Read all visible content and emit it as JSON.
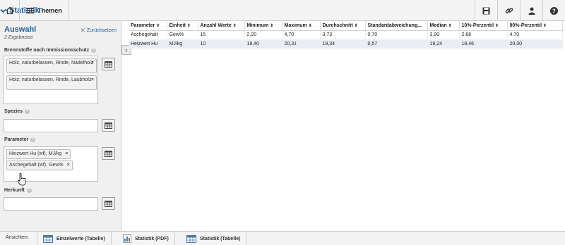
{
  "toolbar": {
    "home_icon": "home-icon",
    "themen_label": "Themen",
    "statistik_label": "Statistik",
    "right_icons": [
      "save-icon",
      "link-icon",
      "user-icon",
      "help-icon"
    ]
  },
  "sidebar": {
    "title": "Auswahl",
    "result_count": "2 Ergebnisse",
    "reset_label": "Zurücksetzen",
    "fuels": {
      "label": "Brennstoffe nach Immissionsschutz",
      "tags": [
        "Holz, naturbelassen, Rinde, Nadelholz",
        "Holz, naturbelassen, Rinde, Laubholz"
      ]
    },
    "species": {
      "label": "Spezies",
      "value": ""
    },
    "parameter": {
      "label": "Parameter",
      "tags": [
        "Heizwert Hu (wf), MJ/kg",
        "Aschegehalt (wf), Gew%"
      ]
    },
    "origin": {
      "label": "Herkunft",
      "value": ""
    }
  },
  "table": {
    "headers": [
      "Parameter",
      "Einheit",
      "Anzahl Werte",
      "Minimum",
      "Maximum",
      "Durchschnitt",
      "Standardabweichung...",
      "Median",
      "10%-Perzentil",
      "90%-Perzentil"
    ],
    "rows": [
      [
        "Aschegehalt",
        "Gew%",
        "15",
        "2,20",
        "4,70",
        "3,73",
        "0,70",
        "3,90",
        "2,68",
        "4,70"
      ],
      [
        "Heizwert Hu",
        "MJ/kg",
        "10",
        "18,40",
        "20,31",
        "19,34",
        "0,57",
        "19,24",
        "18,46",
        "20,30"
      ]
    ]
  },
  "bottom": {
    "label": "Ansichten:",
    "views": [
      "Einzelwerte (Tabelle)",
      "Statistik (PDF)",
      "Statistik (Tabelle)"
    ]
  },
  "colors": {
    "accent": "#1f5d9a",
    "alt_row": "#e9edf5"
  }
}
